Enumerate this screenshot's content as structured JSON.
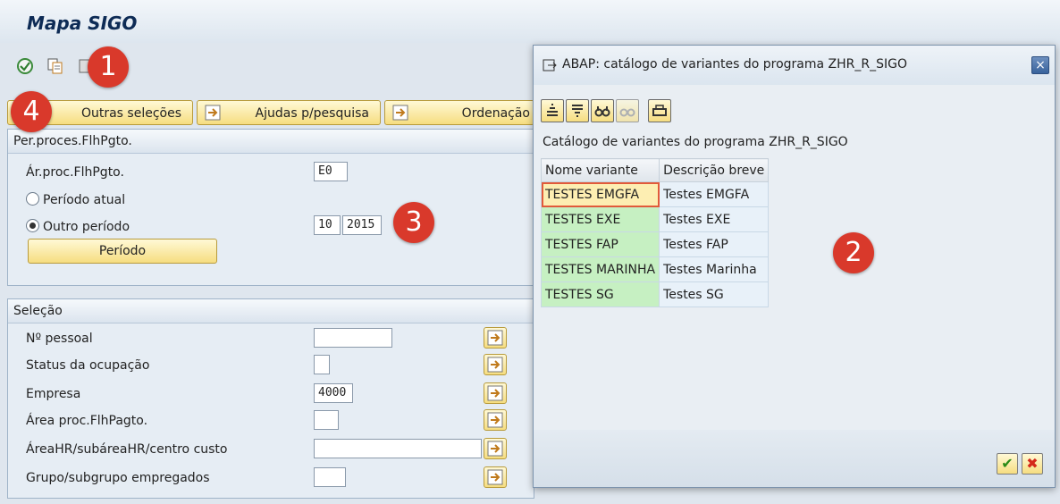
{
  "app": {
    "title": "Mapa SIGO"
  },
  "buttons": {
    "outras_selecoes": "Outras seleções",
    "ajudas_pesquisa": "Ajudas p/pesquisa",
    "ordenacao": "Ordenação"
  },
  "group_period": {
    "title": "Per.proces.FlhPgto.",
    "area_label": "Ár.proc.FlhPgto.",
    "area_value": "E0",
    "periodo_atual_label": "Período atual",
    "outro_periodo_label": "Outro período",
    "period_month": "10",
    "period_year": "2015",
    "periodo_button": "Período"
  },
  "group_selection": {
    "title": "Seleção",
    "rows": [
      {
        "label": "Nº pessoal",
        "value": ""
      },
      {
        "label": "Status da ocupação",
        "value": ""
      },
      {
        "label": "Empresa",
        "value": "4000"
      },
      {
        "label": "Área proc.FlhPagto.",
        "value": ""
      },
      {
        "label": "ÁreaHR/subáreaHR/centro custo",
        "value": ""
      },
      {
        "label": "Grupo/subgrupo empregados",
        "value": ""
      }
    ]
  },
  "dialog": {
    "title": "ABAP: catálogo de variantes do programa ZHR_R_SIGO",
    "caption": "Catálogo de variantes do programa ZHR_R_SIGO",
    "columns": [
      "Nome variante",
      "Descrição breve"
    ],
    "rows": [
      {
        "name": "TESTES EMGFA",
        "desc": "Testes EMGFA"
      },
      {
        "name": "TESTES EXE",
        "desc": "Testes EXE"
      },
      {
        "name": "TESTES FAP",
        "desc": "Testes FAP"
      },
      {
        "name": "TESTES MARINHA",
        "desc": "Testes Marinha"
      },
      {
        "name": "TESTES SG",
        "desc": "Testes SG"
      }
    ],
    "close_glyph": "×",
    "ok_glyph": "✔",
    "cancel_glyph": "✖"
  },
  "annotations": {
    "b1": "1",
    "b2": "2",
    "b3": "3",
    "b4": "4"
  },
  "icons": [
    "execute-icon",
    "get-variant-icon",
    "choose-icon",
    "multiple-selection-icon"
  ],
  "colors": {
    "badge": "#d9392b",
    "button_yellow": "#f6dd80",
    "selected_variant": "#fdeeb2",
    "variant_cell": "#c6f0c2"
  }
}
